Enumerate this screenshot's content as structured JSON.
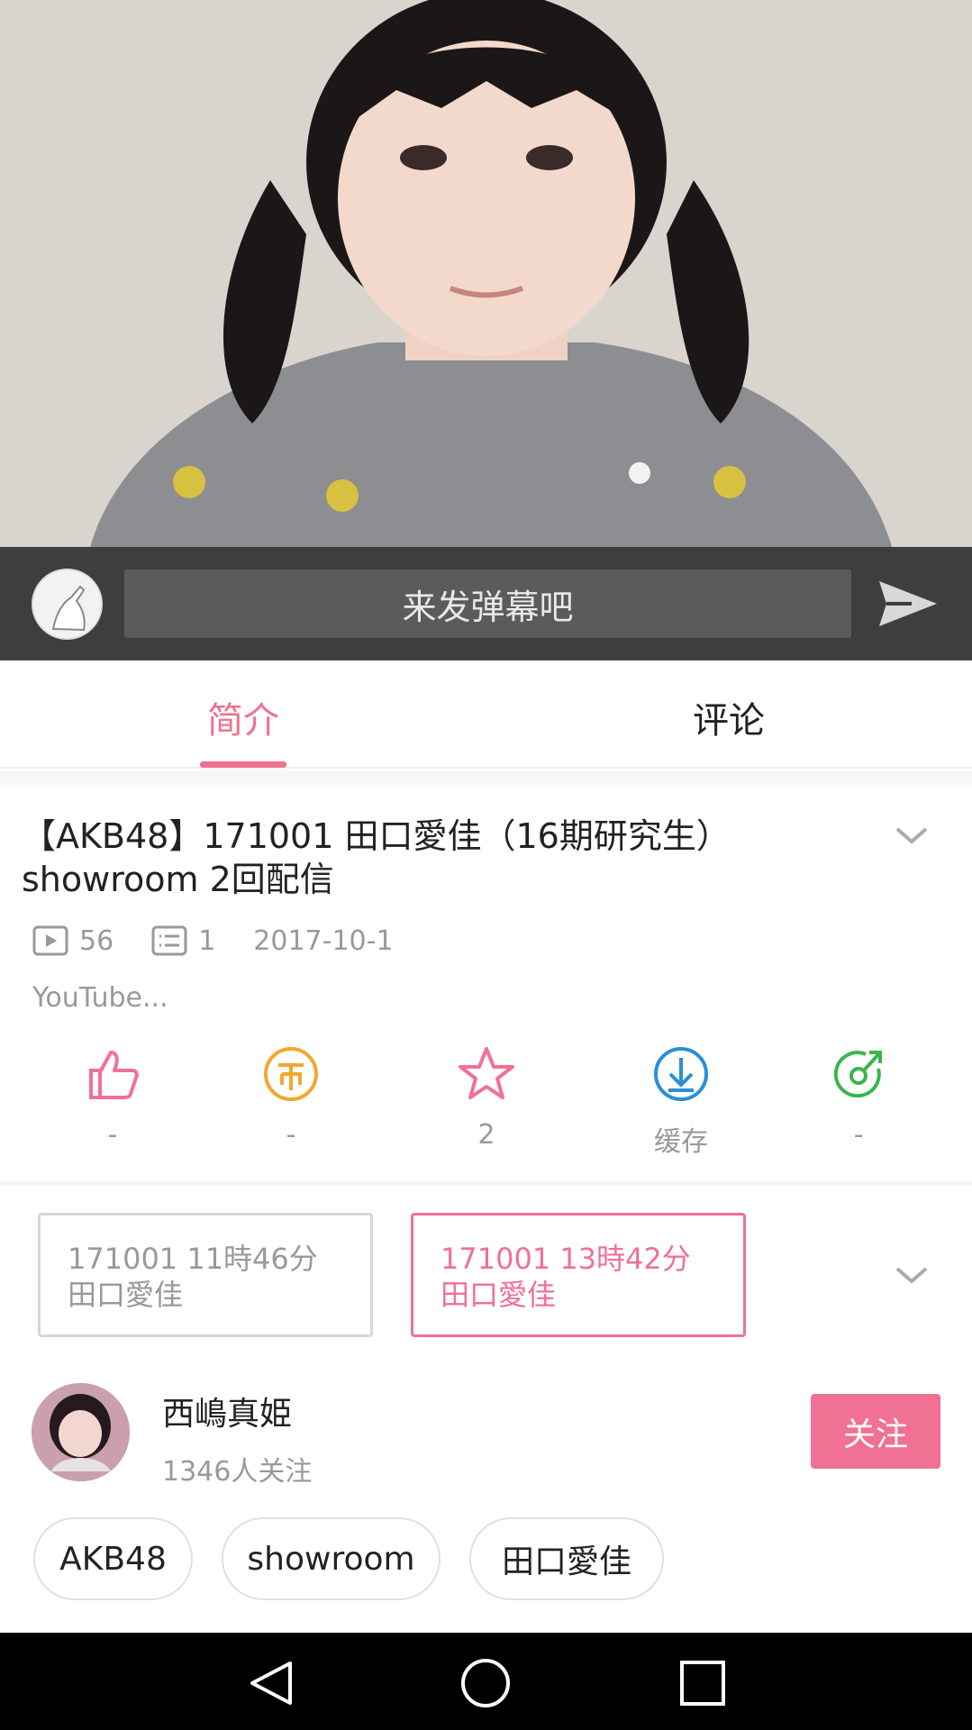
{
  "danmaku": {
    "placeholder": "来发弹幕吧"
  },
  "tabs": [
    {
      "label": "简介"
    },
    {
      "label": "评论"
    }
  ],
  "video_info": {
    "title": "【AKB48】171001 田口愛佳（16期研究生） showroom 2回配信",
    "plays": "56",
    "danmaku_count": "1",
    "date": "2017-10-1",
    "description": "YouTube..."
  },
  "actions": [
    {
      "icon": "thumbs-up-icon",
      "label": "-"
    },
    {
      "icon": "coin-icon",
      "label": "-"
    },
    {
      "icon": "star-icon",
      "label": "2"
    },
    {
      "icon": "download-icon",
      "label": "缓存"
    },
    {
      "icon": "share-icon",
      "label": "-"
    }
  ],
  "parts": [
    {
      "line1": "171001 11時46分",
      "line2": "田口愛佳",
      "active": false
    },
    {
      "line1": "171001 13時42分",
      "line2": "田口愛佳",
      "active": true
    }
  ],
  "uploader": {
    "name": "西嶋真姫",
    "followers": "1346人关注",
    "follow_label": "关注"
  },
  "tags": [
    "AKB48",
    "showroom",
    "田口愛佳"
  ],
  "colors": {
    "accent": "#f07193",
    "danmaku_bar": "#3e3e40",
    "muted": "#999999",
    "download": "#2b8fd6",
    "share": "#39b54a",
    "coin": "#f0a830"
  }
}
